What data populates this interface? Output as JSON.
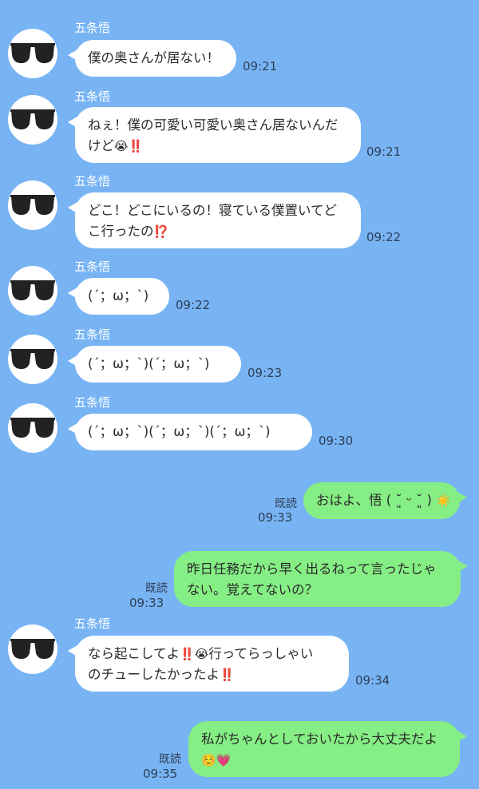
{
  "contact": {
    "name": "五条悟"
  },
  "messages": [
    {
      "from": "contact",
      "text": "僕の奥さんが居ない！",
      "time": "09:21"
    },
    {
      "from": "contact",
      "line1": "ねぇ！僕の可愛い可愛い奥さん居ないんだ",
      "line2_text": "けど",
      "line2_emoji": [
        "😭",
        "‼️"
      ],
      "time": "09:21"
    },
    {
      "from": "contact",
      "line1": "どこ！どこにいるの！寝ている僕置いてど",
      "line2_text": "こ行ったの",
      "line2_emoji": [
        "⁉️"
      ],
      "time": "09:22"
    },
    {
      "from": "contact",
      "text": "(´；ω；`)",
      "time": "09:22"
    },
    {
      "from": "contact",
      "text": "(´；ω；`)(´；ω；`)",
      "time": "09:23"
    },
    {
      "from": "contact",
      "text": "(´；ω；`)(´；ω；`)(´；ω；`)",
      "time": "09:30"
    },
    {
      "from": "me",
      "text": "おはよ、悟 ( ˘͈ ᵕ ˘͈ )",
      "emoji": "☀️",
      "read": "既読",
      "time": "09:33"
    },
    {
      "from": "me",
      "line1": "昨日任務だから早く出るねって言ったじゃ",
      "line2": "ない。覚えてないの？",
      "read": "既読",
      "time": "09:33"
    },
    {
      "from": "contact",
      "line1_text_a": "なら起こしてよ",
      "line1_emoji": [
        "‼️",
        "😭"
      ],
      "line1_text_b": "行ってらっしゃい",
      "line2_text": "のチューしたかったよ",
      "line2_emoji": [
        "‼️"
      ],
      "time": "09:34"
    },
    {
      "from": "me",
      "line1": "私がちゃんとしておいたから大丈夫だよ",
      "line2_emoji": [
        "☺️",
        "💗"
      ],
      "read": "既読",
      "time": "09:35"
    }
  ],
  "colors": {
    "background": "#78b4f4",
    "incoming_bubble": "#ffffff",
    "outgoing_bubble": "#85ee84"
  },
  "icons": {
    "avatar": "sunglasses-icon"
  }
}
